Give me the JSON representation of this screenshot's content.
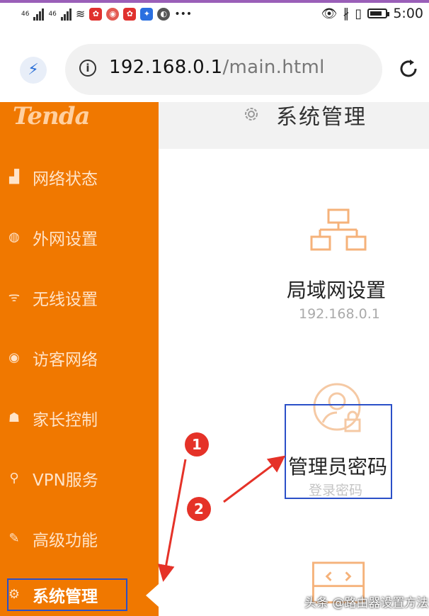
{
  "status_bar": {
    "sim1": "46",
    "sim2": "46",
    "time": "5:00",
    "battery_level_percent": 80
  },
  "browser": {
    "url_host": "192.168.0.1",
    "url_path": "/main.html"
  },
  "sidebar": {
    "logo": "Tenda",
    "items": [
      {
        "label": "网络状态",
        "icon": "network-status-icon"
      },
      {
        "label": "外网设置",
        "icon": "globe-icon"
      },
      {
        "label": "无线设置",
        "icon": "wifi-icon"
      },
      {
        "label": "访客网络",
        "icon": "guest-icon"
      },
      {
        "label": "家长控制",
        "icon": "parental-icon"
      },
      {
        "label": "VPN服务",
        "icon": "vpn-icon"
      },
      {
        "label": "高级功能",
        "icon": "tools-icon"
      },
      {
        "label": "系统管理",
        "icon": "gear-icon",
        "active": true
      }
    ]
  },
  "main": {
    "title": "系统管理",
    "cards": [
      {
        "title": "局域网设置",
        "subtitle": "192.168.0.1",
        "icon": "lan-icon"
      },
      {
        "title": "管理员密码",
        "subtitle": "登录密码",
        "icon": "admin-lock-icon"
      },
      {
        "icon": "code-window-icon"
      }
    ]
  },
  "annotations": {
    "badge1": "1",
    "badge2": "2"
  },
  "watermark": "头条 @路由器设置方法",
  "colors": {
    "sidebar": "#f07800",
    "accent_icon": "#f5b27a",
    "highlight": "#2b50c8",
    "badge": "#e53228"
  }
}
